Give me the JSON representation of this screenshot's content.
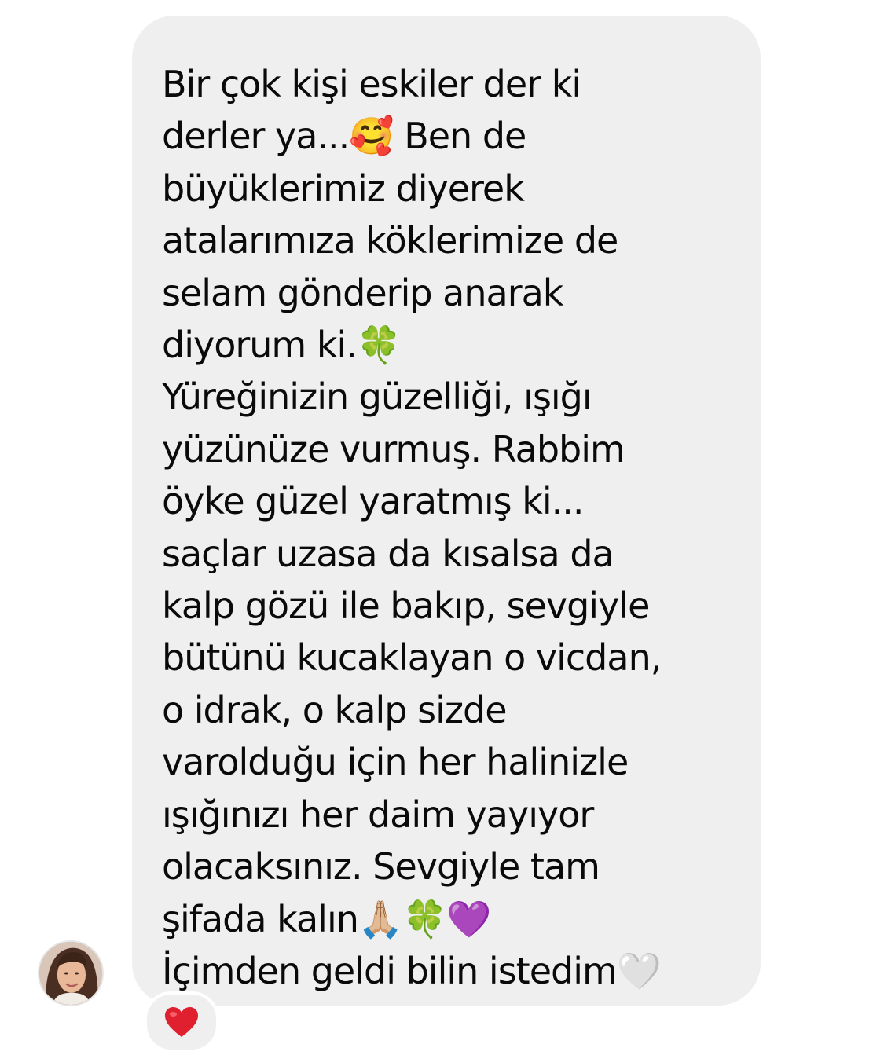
{
  "conversation": {
    "message": {
      "text": "Bir çok kişi eskiler der ki\nderler ya...🥰 Ben de\nbüyüklerimiz diyerek\natalarımıza köklerimize de\nselam gönderip anarak\ndiyorum ki.🍀\nYüreğinizin güzelliği, ışığı\nyüzünüze vurmuş. Rabbim\nöyke güzel yaratmış ki...\nsaçlar uzasa da kısalsa da\nkalp gözü ile bakıp, sevgiyle\nbütünü kucaklayan o vicdan,\no idrak, o kalp sizde\nvarolduğu için her halinizle\nışığınızı her daim yayıyor\nolacaksınız. Sevgiyle tam\nşifada kalın🙏🏼🍀💜\nİçimden geldi bilin istedim🤍",
      "bubble_color": "#efefef",
      "text_color": "#0a0a0a"
    },
    "sender": {
      "avatar_icon": "profile-photo"
    },
    "reaction": {
      "icon": "red-heart-icon",
      "color": "#e0202e"
    }
  }
}
